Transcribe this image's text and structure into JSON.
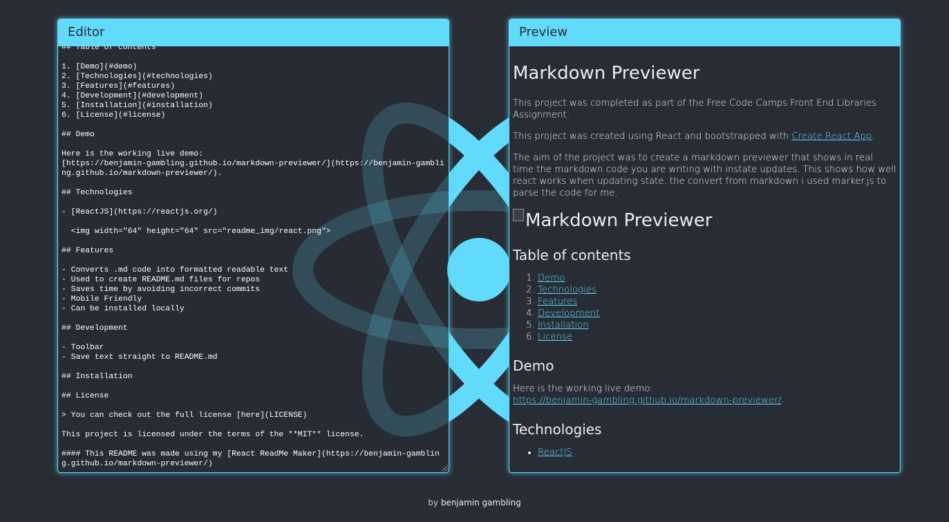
{
  "colors": {
    "background": "#282c34",
    "accent": "#61dafb",
    "text": "#e9eef2"
  },
  "editor": {
    "title": "Editor",
    "content": "## Table of contents\n\n1. [Demo](#demo)\n2. [Technologies](#technologies)\n3. [Features](#features)\n4. [Development](#development)\n5. [Installation](#installation)\n6. [License](#license)\n\n## Demo\n\nHere is the working live demo:\n[https://benjamin-gambling.github.io/markdown-previewer/](https://benjamin-gambling.github.io/markdown-previewer/).\n\n## Technologies\n\n- [ReactJS](https://reactjs.org/)\n\n  <img width=\"64\" height=\"64\" src=\"readme_img/react.png\">\n\n## Features\n\n- Converts .md code into formatted readable text\n- Used to create README.md files for repos\n- Saves time by avoiding incorrect commits\n- Mobile Friendly\n- Can be installed locally\n\n## Development\n\n- Toolbar\n- Save text straight to README.md\n\n## Installation\n\n## License\n\n> You can check out the full license [here](LICENSE)\n\nThis project is licensed under the terms of the **MIT** license.\n\n#### This README was made using my [React ReadMe Maker](https://benjamin-gambling.github.io/markdown-previewer/)"
  },
  "preview": {
    "title": "Preview",
    "h1": "Markdown Previewer",
    "p1": "This project was completed as part of the Free Code Camps Front End Libraries Assignment.",
    "p2_text": "This project was created using React and bootstrapped with ",
    "p2_link": "Create React App",
    "p2_end": ".",
    "p3": "The aim of the project was to create a markdown previewer that shows in real time the markdown code you are writing with instate updates. This shows how well react works when updating state. the convert from markdown i used marker.js to parse the code for me.",
    "img_alt": "Markdown Previewer",
    "toc_heading": "Table of contents",
    "toc_items": [
      "Demo",
      "Technologies",
      "Features",
      "Development",
      "Installation",
      "License"
    ],
    "demo_heading": "Demo",
    "demo_text": "Here is the working live demo:",
    "demo_link": "https://benjamin-gambling.github.io/markdown-previewer/",
    "demo_end": ".",
    "tech_heading": "Technologies",
    "tech_items": [
      "ReactJS"
    ]
  },
  "footer": {
    "by": "by",
    "author": "benjamin gambling"
  }
}
